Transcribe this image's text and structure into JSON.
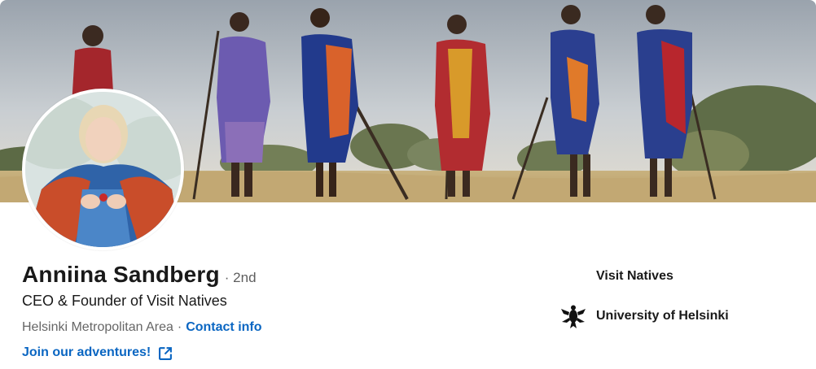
{
  "profile": {
    "name": "Anniina Sandberg",
    "degree": "· 2nd",
    "headline": "CEO & Founder of Visit Natives",
    "location": "Helsinki Metropolitan Area",
    "separator": "·",
    "contact_label": "Contact info",
    "website_label": "Join our adventures!"
  },
  "experience": [
    {
      "label": "Visit Natives",
      "logo": "none"
    },
    {
      "label": "University of Helsinki",
      "logo": "university-of-helsinki-logo"
    }
  ],
  "icons": {
    "external_link": "external-link-icon"
  },
  "colors": {
    "link": "#0a66c2",
    "text": "#191919",
    "muted": "#666666"
  }
}
